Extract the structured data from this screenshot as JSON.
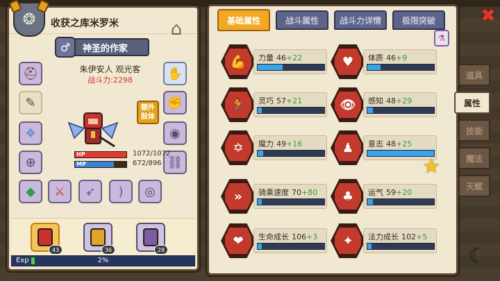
{
  "character": {
    "title": "收获之库米罗米",
    "rank_title": "神圣的作家",
    "name": "朱伊安人 观光客",
    "combat_power": "战斗力:2298",
    "extra_limb_button": "额外肢体",
    "hp": {
      "label": "HP",
      "value": "1072/1072",
      "ratio": 1.0
    },
    "mp": {
      "label": "MP",
      "value": "672/896",
      "ratio": 0.75
    },
    "exp": {
      "label": "Exp",
      "value": "2%",
      "ratio": 0.02
    }
  },
  "team": [
    {
      "level": "43",
      "color": "#c9312c",
      "active": true
    },
    {
      "level": "36",
      "color": "#e0a62a",
      "active": false
    },
    {
      "level": "28",
      "color": "#7b5da0",
      "active": false
    }
  ],
  "tabs": [
    {
      "label": "基础属性",
      "active": true
    },
    {
      "label": "战斗属性",
      "active": false
    },
    {
      "label": "战斗力详情",
      "active": false
    },
    {
      "label": "极限突破",
      "active": false
    }
  ],
  "stats": [
    {
      "name": "力量",
      "base": "46",
      "bonus": "+22",
      "fill": 0.38,
      "icon": "strength-icon",
      "glyph": "💪"
    },
    {
      "name": "体质",
      "base": "46",
      "bonus": "+9",
      "fill": 0.2,
      "icon": "vitality-icon",
      "glyph": "♥"
    },
    {
      "name": "灵巧",
      "base": "57",
      "bonus": "+21",
      "fill": 0.06,
      "icon": "agility-icon",
      "glyph": "🏃"
    },
    {
      "name": "感知",
      "base": "48",
      "bonus": "+29",
      "fill": 0.08,
      "icon": "perception-icon",
      "glyph": "👁"
    },
    {
      "name": "魔力",
      "base": "49",
      "bonus": "+16",
      "fill": 0.08,
      "icon": "magic-icon",
      "glyph": "✡"
    },
    {
      "name": "意志",
      "base": "48",
      "bonus": "+25",
      "fill": 1.0,
      "icon": "will-icon",
      "glyph": "♟"
    },
    {
      "name": "骑乘速度",
      "base": "70",
      "bonus": "+80",
      "fill": 0.06,
      "icon": "riding-speed-icon",
      "glyph": "»"
    },
    {
      "name": "运气",
      "base": "59",
      "bonus": "+20",
      "fill": 0.08,
      "icon": "luck-icon",
      "glyph": "♣"
    },
    {
      "name": "生命成长",
      "base": "106",
      "bonus": "+3",
      "fill": 0.06,
      "icon": "life-growth-icon",
      "glyph": "❤"
    },
    {
      "name": "法力成长",
      "base": "102",
      "bonus": "+5",
      "fill": 0.06,
      "icon": "mana-growth-icon",
      "glyph": "✦"
    }
  ],
  "side_menu": [
    {
      "label": "道具",
      "active": false
    },
    {
      "label": "属性",
      "active": true
    },
    {
      "label": "技能",
      "active": false
    },
    {
      "label": "魔法",
      "active": false
    },
    {
      "label": "天赋",
      "active": false
    }
  ],
  "colors": {
    "accent": "#f2a820",
    "tab_inactive": "#5e6489",
    "bonus": "#3f9a2e",
    "power": "#d4332d"
  }
}
